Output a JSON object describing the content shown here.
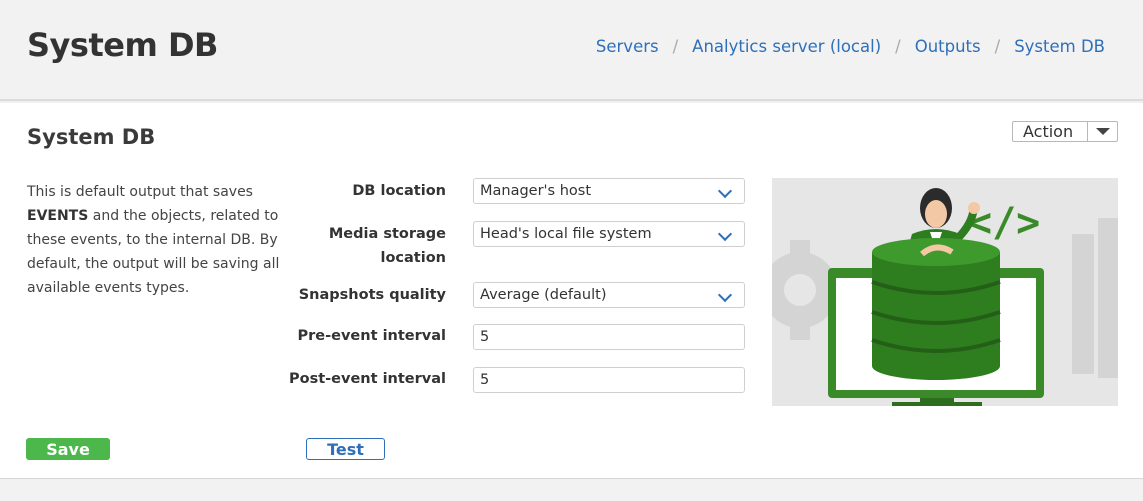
{
  "header": {
    "title": "System DB",
    "breadcrumb": [
      "Servers",
      "Analytics server (local)",
      "Outputs",
      "System DB"
    ]
  },
  "card": {
    "title": "System DB",
    "action_label": "Action",
    "description": {
      "part1": "This is default output that saves ",
      "bold": "EVENTS",
      "part2": " and the objects, related to these events, to the internal DB. By default, the output will be saving all available events types."
    },
    "fields": {
      "db_location": {
        "label": "DB location",
        "value": "Manager's host"
      },
      "media_storage": {
        "label_line1": "Media storage",
        "label_line2": "location",
        "value": "Head's local file system"
      },
      "snapshots_quality": {
        "label": "Snapshots quality",
        "value": "Average (default)"
      },
      "pre_event": {
        "label": "Pre-event interval",
        "value": "5"
      },
      "post_event": {
        "label": "Post-event interval",
        "value": "5"
      }
    },
    "save_label": "Save",
    "test_label": "Test"
  },
  "colors": {
    "link": "#2f6fba",
    "save": "#4cb84c",
    "illustration_green": "#2e7d1f"
  }
}
